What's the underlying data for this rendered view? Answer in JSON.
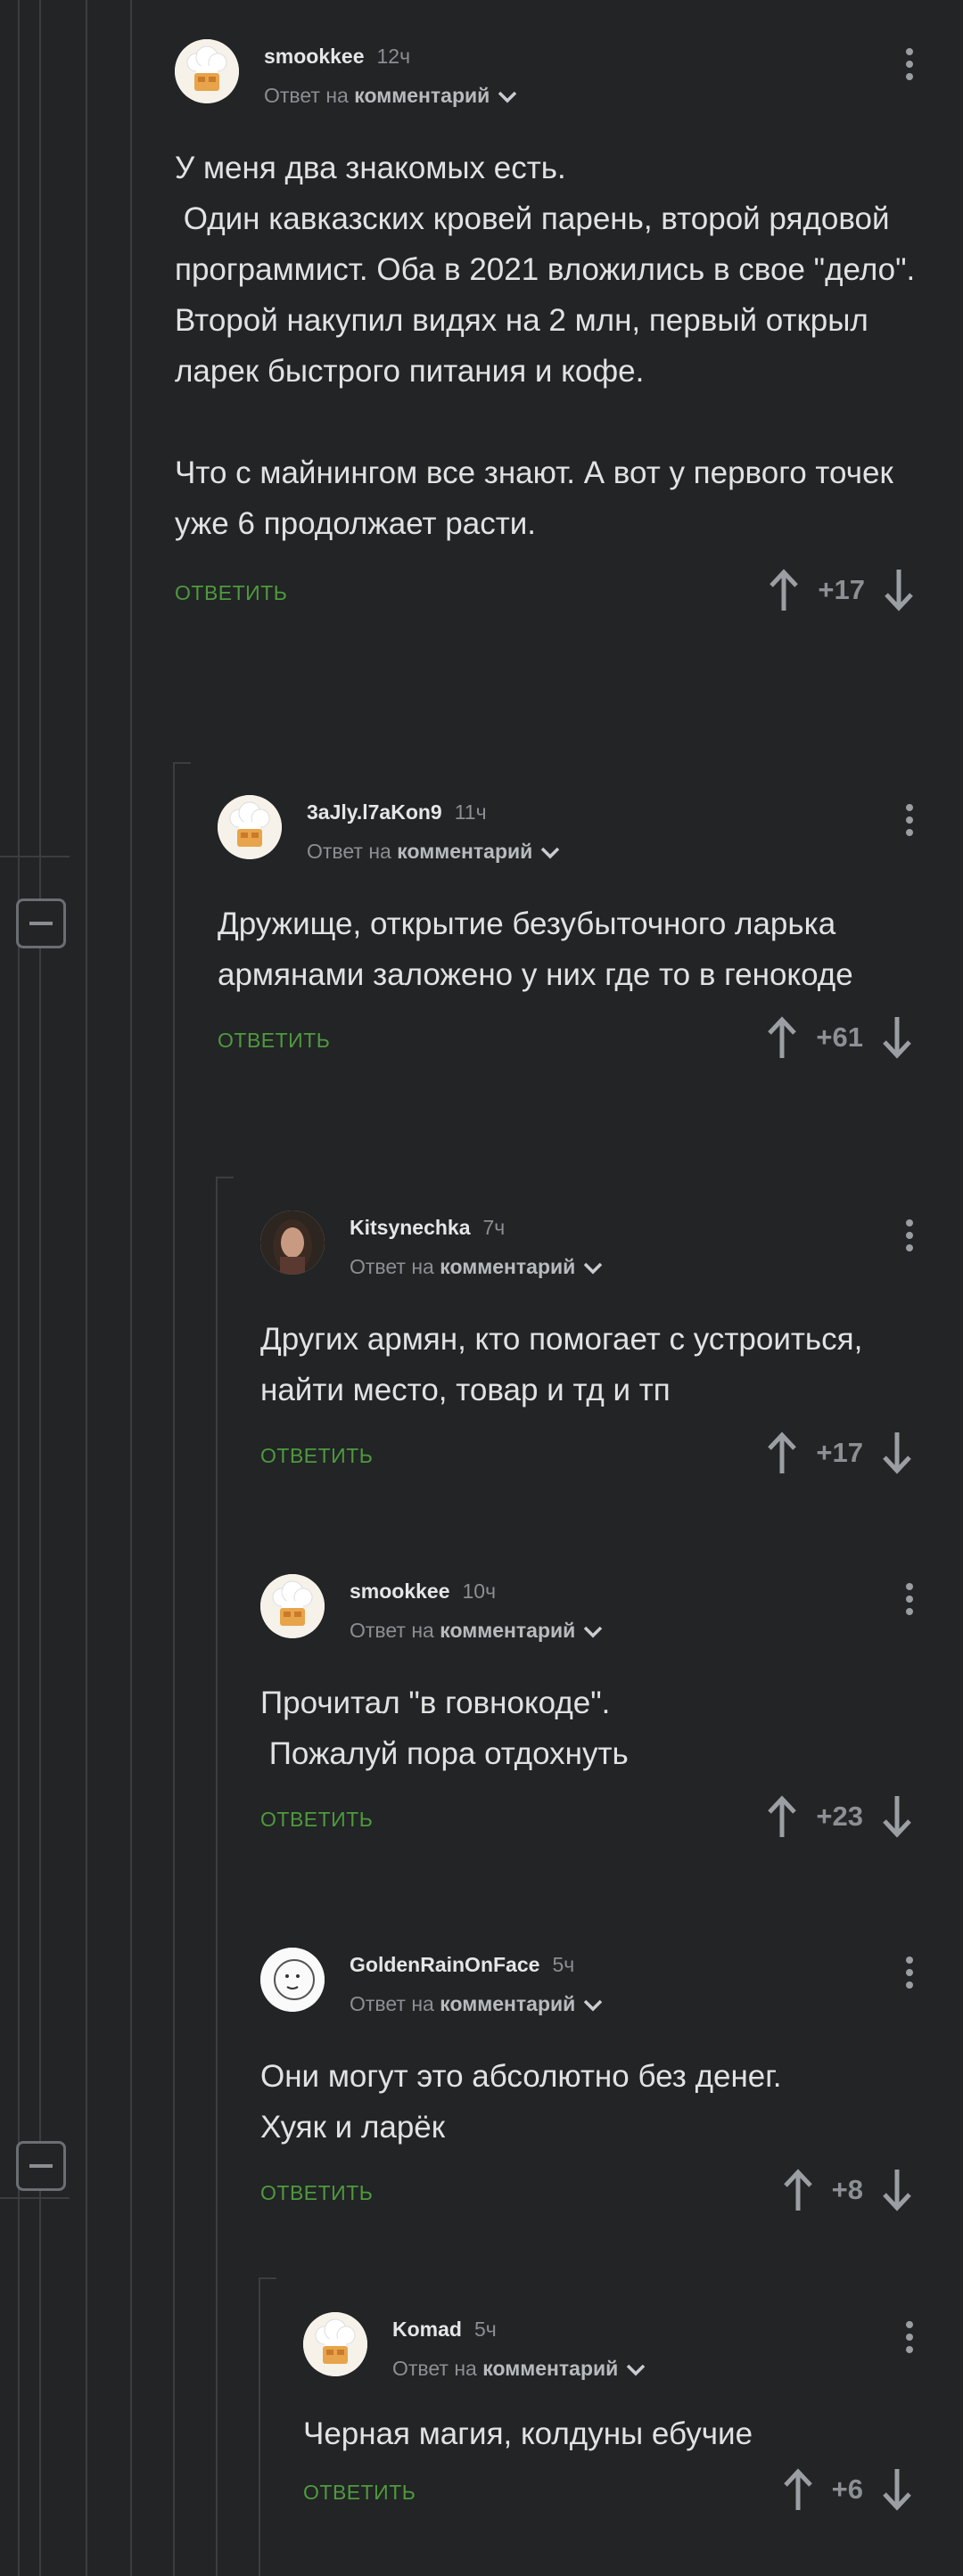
{
  "reply_label": "ОТВЕТИТЬ",
  "reply_prefix": "Ответ на",
  "reply_target": "комментарий",
  "comments": [
    {
      "author": "smookkee",
      "time": "12ч",
      "avatar": "chef-hat",
      "rating": "+17",
      "text": "У меня два знакомых есть.\n Один кавказских кровей парень, второй рядовой программист. Оба в 2021 вложились в свое \"дело\". Второй накупил видях на 2 млн, первый открыл ларек быстрого питания и кофе.\n\nЧто с майнингом все знают. А вот у первого точек уже 6 продолжает расти."
    },
    {
      "author": "3aJly.l7aKon9",
      "time": "11ч",
      "avatar": "chef-hat",
      "rating": "+61",
      "text": "Дружище, открытие безубыточного ларька армянами заложено у них где то в генокоде"
    },
    {
      "author": "Kitsynechka",
      "time": "7ч",
      "avatar": "portrait",
      "rating": "+17",
      "text": "Других армян, кто помогает с устроиться, найти место, товар и тд и тп"
    },
    {
      "author": "smookkee",
      "time": "10ч",
      "avatar": "chef-hat",
      "rating": "+23",
      "text": "Прочитал \"в говнокоде\".\n Пожалуй пора отдохнуть"
    },
    {
      "author": "GoldenRainOnFace",
      "time": "5ч",
      "avatar": "sketch",
      "rating": "+8",
      "text": "Они могут это абсолютно без денег.\nХуяк и ларёк"
    },
    {
      "author": "Komad",
      "time": "5ч",
      "avatar": "chef-hat",
      "rating": "+6",
      "text": "Черная магия, колдуны ебучие"
    }
  ]
}
